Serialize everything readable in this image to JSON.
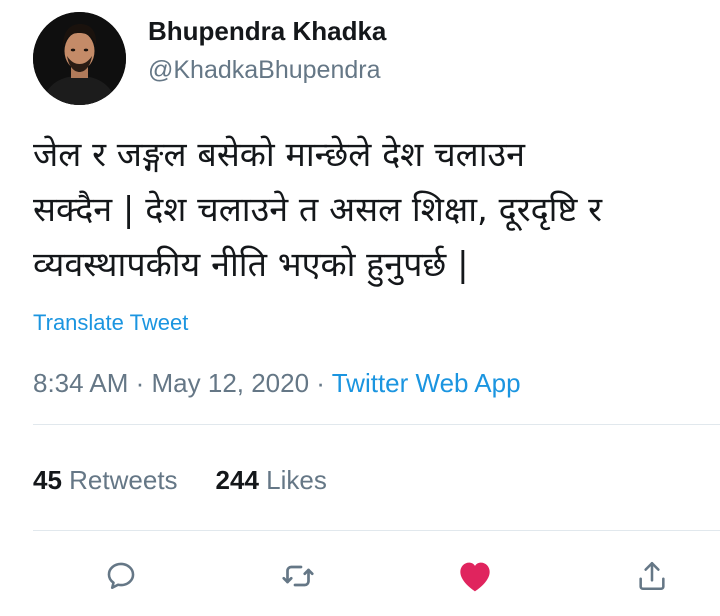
{
  "user": {
    "name": "Bhupendra Khadka",
    "handle": "@KhadkaBhupendra"
  },
  "tweet": {
    "lines": [
      "जेल र जङ्गल बसेको मान्छेले देश चलाउन",
      "सक्दैन | देश चलाउने त असल शिक्षा, दूरदृष्टि र",
      "व्यवस्थापकीय नीति भएको हुनुपर्छ |"
    ],
    "translate_label": "Translate Tweet",
    "time": "8:34 AM",
    "sep1": " · ",
    "date": "May 12, 2020",
    "sep2": " · ",
    "source": "Twitter Web App"
  },
  "stats": {
    "retweets_count": "45",
    "retweets_label": "Retweets",
    "likes_count": "244",
    "likes_label": "Likes"
  },
  "actions": {
    "icons": [
      "reply-icon",
      "retweet-icon",
      "like-icon",
      "share-icon"
    ],
    "like_color": "#e0245e",
    "icon_color": "#657786"
  },
  "colors": {
    "link": "#1b95e0",
    "secondary": "#657786",
    "text": "#14171a"
  }
}
